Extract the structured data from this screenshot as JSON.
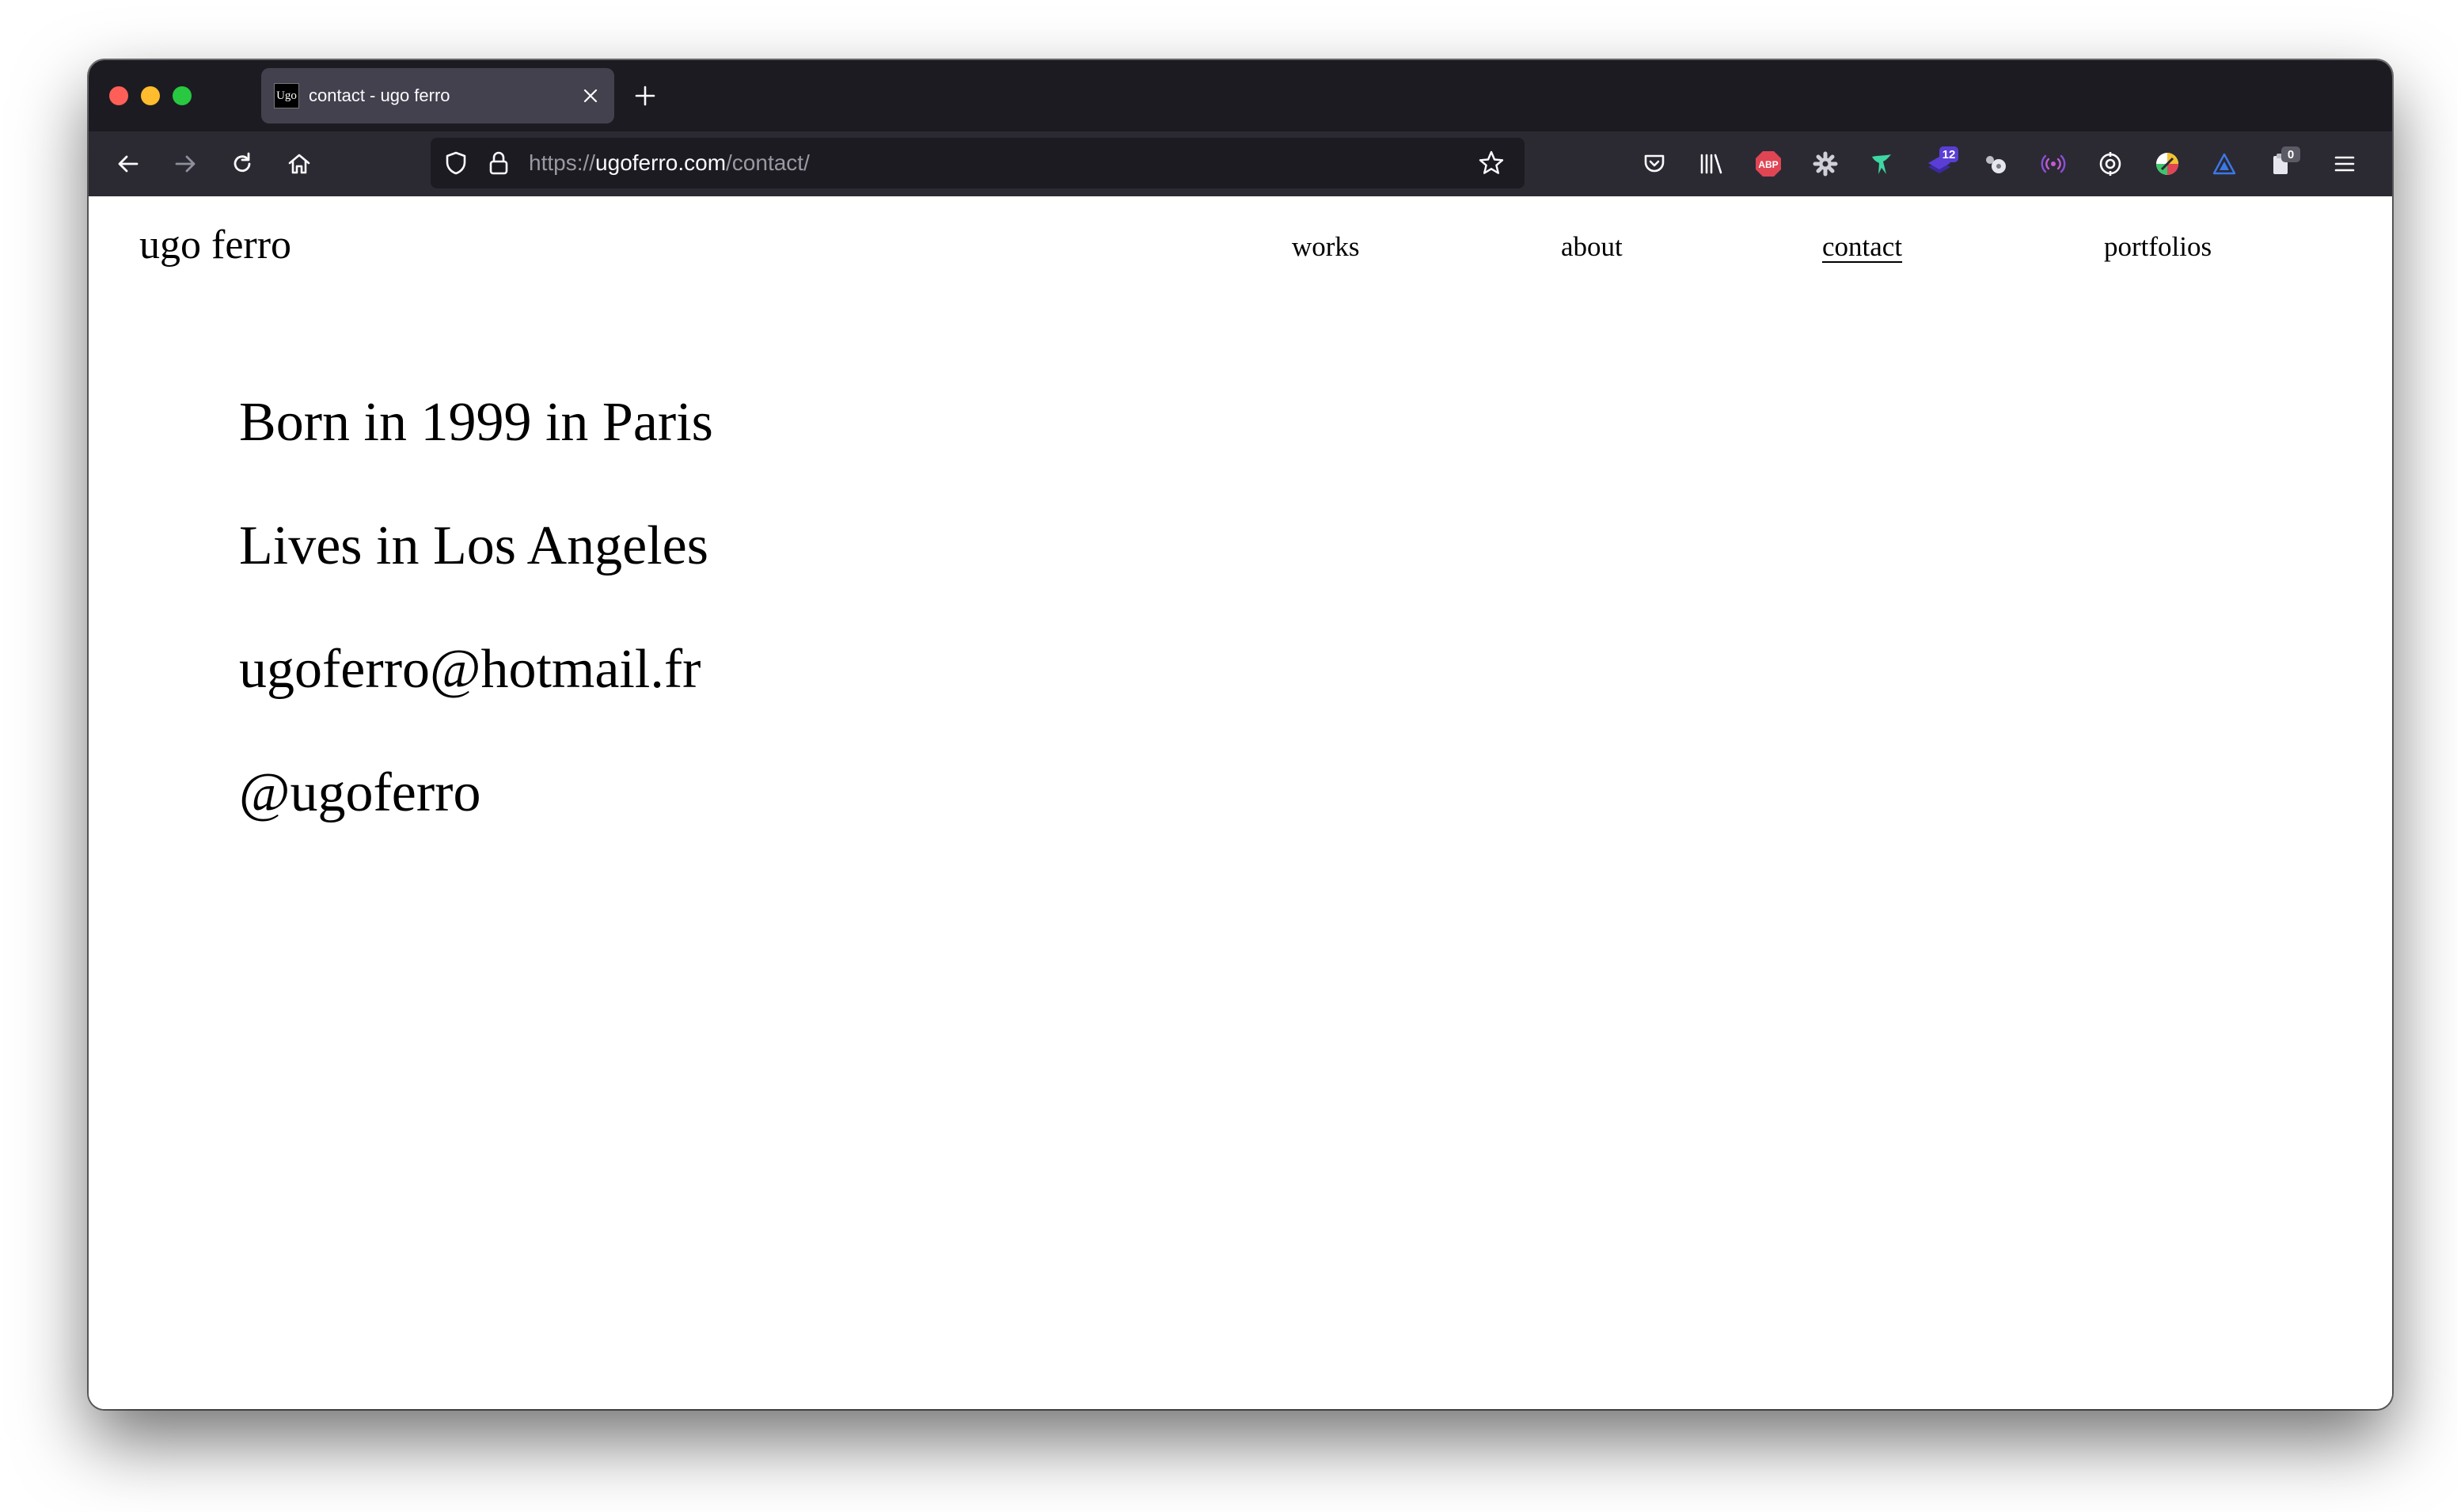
{
  "browser": {
    "tab": {
      "favicon_text": "Ugo",
      "title": "contact - ugo ferro"
    },
    "url": {
      "scheme": "https://",
      "host": "ugoferro.com",
      "path": "/contact/"
    },
    "extensions": [
      {
        "name": "pocket-icon"
      },
      {
        "name": "library-icon"
      },
      {
        "name": "adblock-plus-icon",
        "label": "ABP",
        "color": "#e04554"
      },
      {
        "name": "gear-extension-icon"
      },
      {
        "name": "bird-extension-icon",
        "color": "#3ed6a3"
      },
      {
        "name": "stack-extension-icon",
        "badge": "12",
        "color": "#5a3ed6"
      },
      {
        "name": "cookie-extension-icon"
      },
      {
        "name": "signal-extension-icon",
        "color": "#c35bd6"
      },
      {
        "name": "target-extension-icon"
      },
      {
        "name": "color-wheel-extension-icon"
      },
      {
        "name": "triangle-extension-icon",
        "color": "#3b78e7"
      },
      {
        "name": "clipboard-extension-icon",
        "badge": "0"
      }
    ]
  },
  "site": {
    "title": "ugo ferro",
    "nav": [
      {
        "label": "works",
        "active": false
      },
      {
        "label": "about",
        "active": false
      },
      {
        "label": "contact",
        "active": true
      },
      {
        "label": "portfolios",
        "active": false
      }
    ],
    "contact_lines": [
      "Born in 1999 in Paris",
      "Lives in Los Angeles",
      "ugoferro@hotmail.fr",
      "@ugoferro"
    ]
  }
}
